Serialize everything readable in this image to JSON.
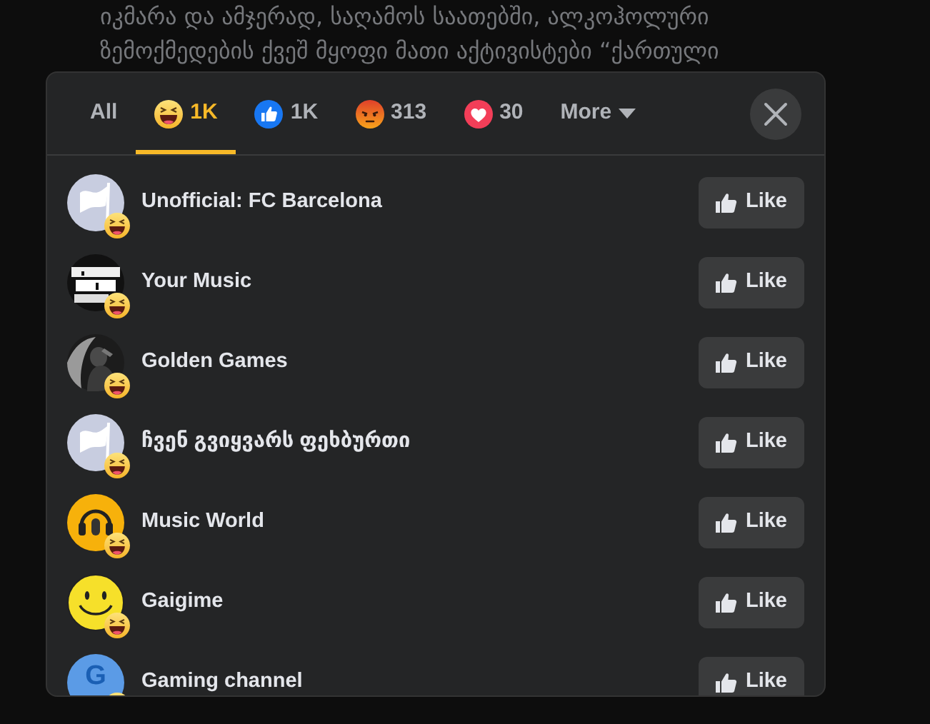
{
  "post": {
    "lines": [
      "იკმარა და ამჯერად, საღამოს საათებში, ალკოჰოლური",
      "ზემოქმედების ქვეშ მყოფი მათი აქტივისტები “ქართული"
    ]
  },
  "tabs": [
    {
      "kind": "all",
      "label": "All",
      "selected": false
    },
    {
      "kind": "haha",
      "label": "1K",
      "selected": true
    },
    {
      "kind": "like",
      "label": "1K",
      "selected": false
    },
    {
      "kind": "angry",
      "label": "313",
      "selected": false
    },
    {
      "kind": "love",
      "label": "30",
      "selected": false
    },
    {
      "kind": "more",
      "label": "More",
      "selected": false
    }
  ],
  "people": [
    {
      "name": "Unofficial: FC Barcelona",
      "kind": "flag",
      "button": "Like"
    },
    {
      "name": "Your Music",
      "kind": "poster",
      "button": "Like"
    },
    {
      "name": "Golden Games",
      "button": "Like"
    },
    {
      "name": "ჩვენ გვიყვარს ფეხბურთი",
      "kind": "flag",
      "button": "Like"
    },
    {
      "name": "Music World",
      "kind": "headphones",
      "button": "Like"
    },
    {
      "name": "Gaigime",
      "kind": "smiley",
      "button": "Like"
    },
    {
      "name": "Gaming channel",
      "kind": "letter",
      "letter": "G",
      "button": "Like"
    }
  ]
}
